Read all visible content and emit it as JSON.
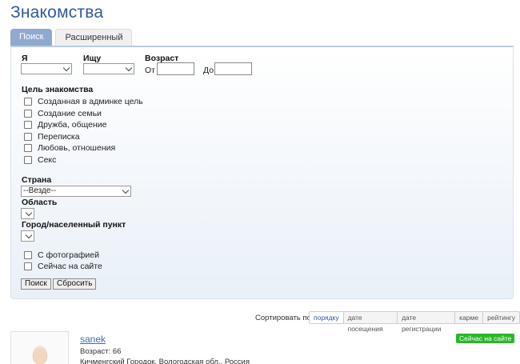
{
  "page": {
    "title": "Знакомства"
  },
  "tabs": [
    {
      "label": "Поиск",
      "active": true
    },
    {
      "label": "Расширенный",
      "active": false
    }
  ],
  "form": {
    "i_label": "Я",
    "seek_label": "Ищу",
    "age_label": "Возраст",
    "age_from_label": "От",
    "age_to_label": "До",
    "goal_label": "Цель знакомства",
    "goals": [
      "Созданная в админке цель",
      "Создание семьи",
      "Дружба, общение",
      "Переписка",
      "Любовь, отношения",
      "Секс"
    ],
    "country_label": "Страна",
    "country_value": "--Везде--",
    "region_label": "Область",
    "city_label": "Город/населенный пункт",
    "with_photo_label": "С фотографией",
    "online_label": "Сейчас на сайте",
    "search_button": "Поиск",
    "reset_button": "Сбросить"
  },
  "sort": {
    "label": "Сортировать по:",
    "options": [
      "порядку",
      "дате посещения",
      "дате регистрации",
      "карме",
      "рейтингу"
    ],
    "active": "порядку"
  },
  "result": {
    "username": "sanek",
    "age_line": "Возраст: 66",
    "location_line": "Кичменгский Городок, Вологодская обл., Россия",
    "status_badge": "Сейчас на сайте",
    "status_color": "#2bb62b"
  },
  "colors": {
    "accent": "#2e5b9a",
    "tab_active": "#8fa9cf"
  }
}
